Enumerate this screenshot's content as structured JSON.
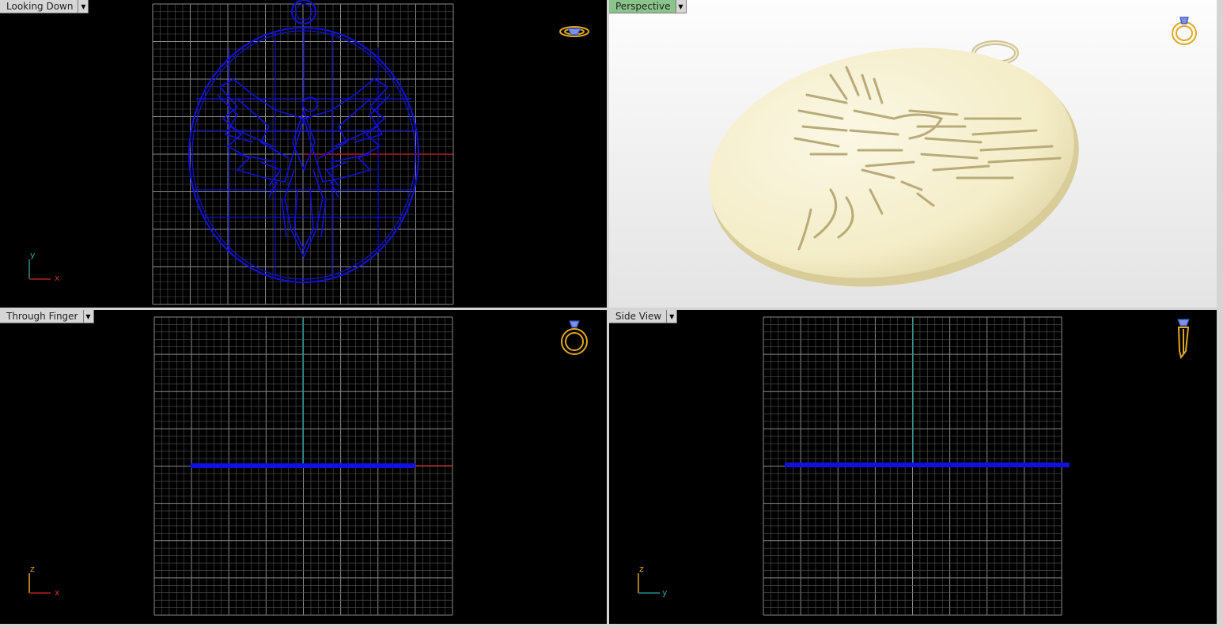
{
  "viewports": {
    "top_left": {
      "label": "Looking Down",
      "icon": "ring-top-view-icon",
      "axis_h": "x",
      "axis_v": "y"
    },
    "top_right": {
      "label": "Perspective",
      "icon": "ring-perspective-icon"
    },
    "bottom_left": {
      "label": "Through Finger",
      "icon": "ring-front-view-icon",
      "axis_h": "x",
      "axis_v": "z"
    },
    "bottom_right": {
      "label": "Side View",
      "icon": "ring-side-view-icon",
      "axis_h": "y",
      "axis_v": "z"
    }
  },
  "colors": {
    "wireframe": "#1010e0",
    "grid": "#5e5e5e",
    "axis_x": "#b02020",
    "axis_y": "#2c8c8c",
    "icon_gold": "#e0a820",
    "render_metal": "#f4efcf"
  }
}
